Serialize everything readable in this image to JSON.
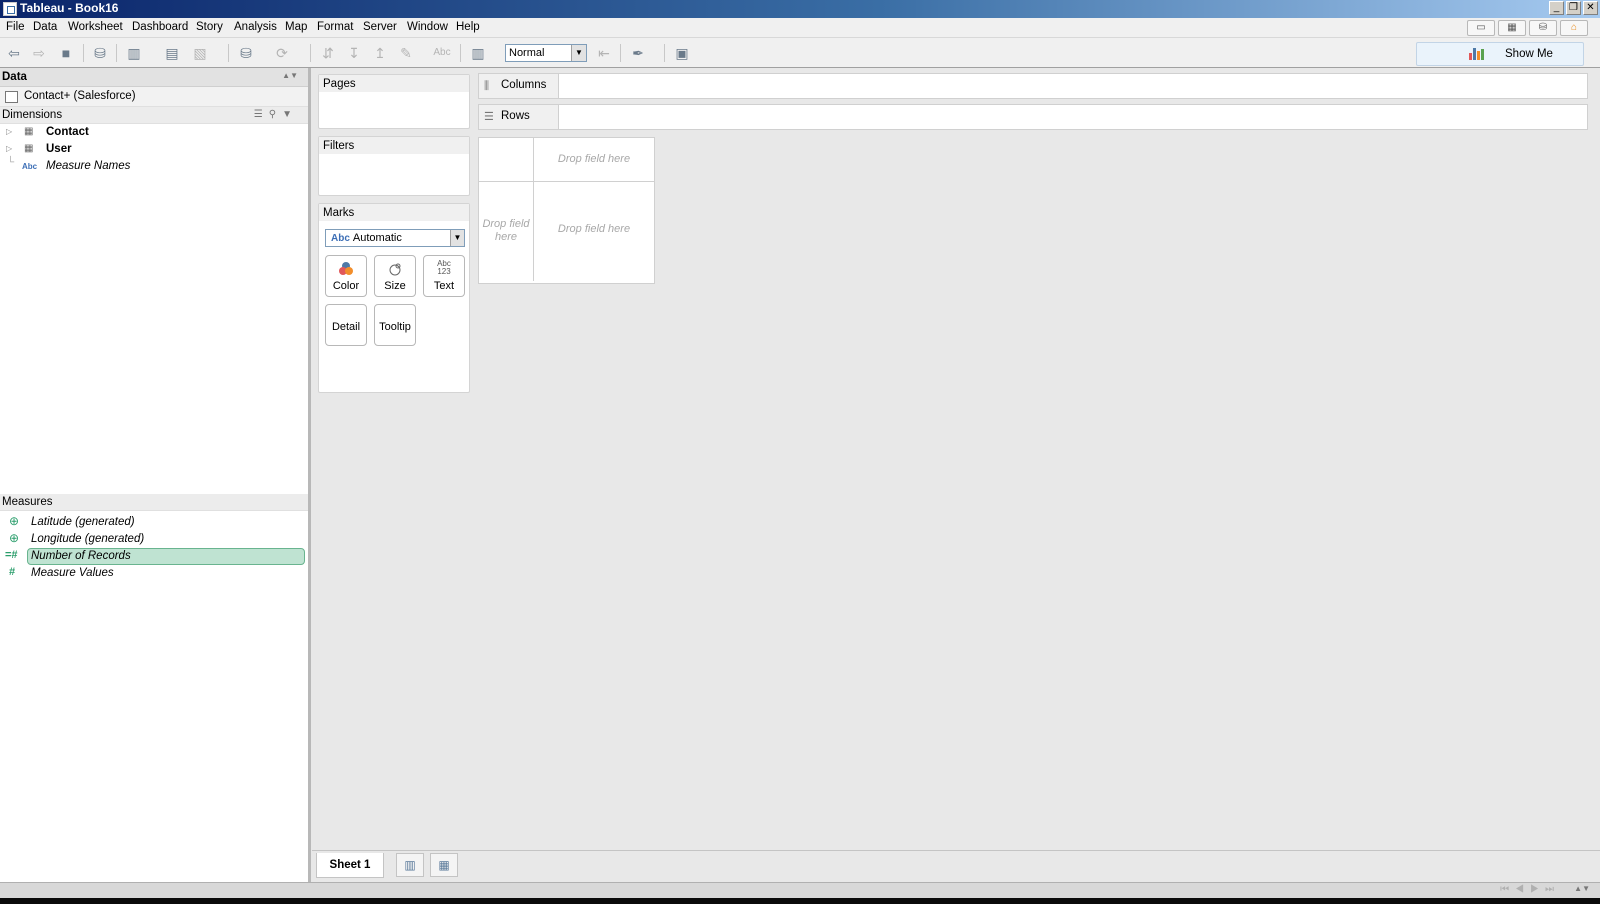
{
  "window": {
    "title": "Tableau - Book16",
    "min": "_",
    "restore": "❐",
    "close": "✕"
  },
  "menu": [
    "File",
    "Data",
    "Worksheet",
    "Dashboard",
    "Story",
    "Analysis",
    "Map",
    "Format",
    "Server",
    "Window",
    "Help"
  ],
  "toolbar": {
    "fit": "Normal",
    "show_me": "Show Me",
    "abc_label": "Abc"
  },
  "data_pane": {
    "header": "Data",
    "datasource": "Contact+ (Salesforce)",
    "dimensions_label": "Dimensions",
    "dimensions": [
      {
        "name": "Contact",
        "icon": "table-icon"
      },
      {
        "name": "User",
        "icon": "table-icon"
      },
      {
        "name": "Measure Names",
        "icon": "abc-icon"
      }
    ],
    "measures_label": "Measures",
    "measures": [
      {
        "name": "Latitude (generated)",
        "icon": "globe-icon"
      },
      {
        "name": "Longitude (generated)",
        "icon": "globe-icon"
      },
      {
        "name": "Number of Records",
        "icon": "hash-icon",
        "selected": true
      },
      {
        "name": "Measure Values",
        "icon": "hash-icon"
      }
    ],
    "abc_glyph": "Abc"
  },
  "cards": {
    "pages": "Pages",
    "filters": "Filters",
    "marks": "Marks",
    "mark_type": "Automatic",
    "mark_type_icon": "Abc",
    "buttons": {
      "color": "Color",
      "size": "Size",
      "text": "Text",
      "detail": "Detail",
      "tooltip": "Tooltip"
    },
    "text_icon_top": "Abc",
    "text_icon_bottom": "123"
  },
  "shelves": {
    "columns": "Columns",
    "rows": "Rows"
  },
  "viz": {
    "drop_top": "Drop field here",
    "drop_left": "Drop field here",
    "drop_main": "Drop field here"
  },
  "sheets": {
    "active": "Sheet 1"
  },
  "colors": {
    "accent": "#3a6ea5",
    "measure_green": "#2b9e6c",
    "selected_pill": "#bfe3d2",
    "dimension_blue": "#3d6fb6"
  }
}
